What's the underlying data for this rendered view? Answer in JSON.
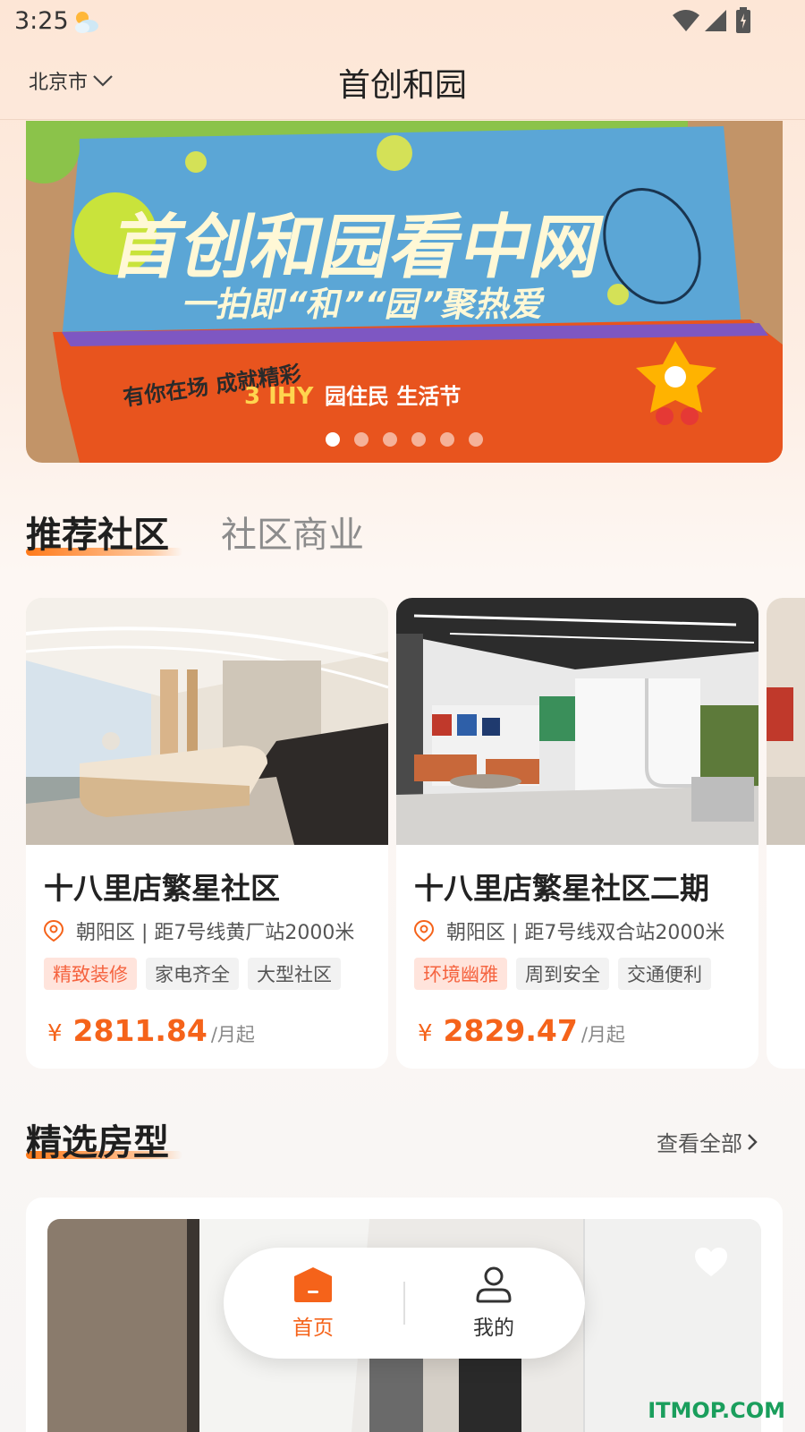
{
  "status_bar": {
    "time": "3:25"
  },
  "header": {
    "city": "北京市",
    "title": "首创和园"
  },
  "banner": {
    "headline": "首创和园看中网",
    "subline": "一拍即“和”“园”聚热爱",
    "badge_left": "有你在场 成就精彩",
    "badge_middle": "3 IHY",
    "badge_right": "园住民 生活节",
    "dot_count": 6,
    "active_dot": 0
  },
  "tabs": [
    {
      "label": "推荐社区",
      "active": true
    },
    {
      "label": "社区商业",
      "active": false
    }
  ],
  "communities": [
    {
      "name": "十八里店繁星社区",
      "location": "朝阳区 | 距7号线黄厂站2000米",
      "tags": [
        "精致装修",
        "家电齐全",
        "大型社区"
      ],
      "currency": "¥",
      "price": "2811.84",
      "unit": "/月起"
    },
    {
      "name": "十八里店繁星社区二期",
      "location": "朝阳区 | 距7号线双合站2000米",
      "tags": [
        "环境幽雅",
        "周到安全",
        "交通便利"
      ],
      "currency": "¥",
      "price": "2829.47",
      "unit": "/月起"
    }
  ],
  "room_section": {
    "title": "精选房型",
    "view_all": "查看全部"
  },
  "bottom_nav": [
    {
      "label": "首页",
      "active": true,
      "icon": "home-icon"
    },
    {
      "label": "我的",
      "active": false,
      "icon": "user-icon"
    }
  ],
  "watermark": "ITMOP.COM",
  "colors": {
    "accent": "#f5631a",
    "tag_highlight_bg": "#ffe4dc",
    "tag_highlight_text": "#f5633f"
  }
}
